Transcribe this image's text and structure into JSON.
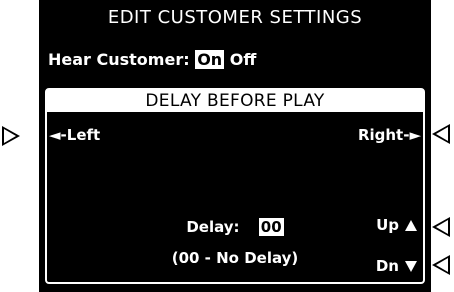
{
  "screen": {
    "title": "EDIT CUSTOMER SETTINGS",
    "hear_customer": {
      "label": "Hear Customer:",
      "on": "On",
      "off": "Off",
      "selected": "On"
    }
  },
  "panel": {
    "header": "DELAY BEFORE PLAY",
    "left_label": "◄-Left",
    "right_label": "Right-►",
    "up_label": "Up",
    "down_label": "Dn",
    "delay_label": "Delay:",
    "delay_value": "00",
    "delay_hint": "(00 - No Delay)"
  },
  "colors": {
    "screen_bg": "#000000",
    "text": "#ffffff",
    "highlight_bg": "#ffffff",
    "highlight_text": "#000000"
  },
  "icons": [
    "left-soft-key-arrow-icon",
    "right-soft-key-arrow-icon",
    "up-triangle-icon",
    "down-triangle-icon"
  ]
}
